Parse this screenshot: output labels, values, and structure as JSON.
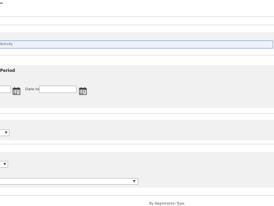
{
  "tabs": {
    "activity_label": "Activity"
  },
  "period_section": {
    "title": "Period",
    "date_from_value": "",
    "date_to_label": "Date to",
    "date_to_value": ""
  },
  "filters": {
    "select_1_value": "",
    "select_2_value": "",
    "select_3_value": ""
  },
  "footer": {
    "by_registration_label": "By Registration Type"
  },
  "icons": {
    "calendar": "calendar-icon",
    "dropdown": "chevron-down-icon"
  },
  "colors": {
    "band_bg": "#f1f1f1",
    "tab_border": "#9fb4d6",
    "tab_bg": "#eef2f8"
  }
}
